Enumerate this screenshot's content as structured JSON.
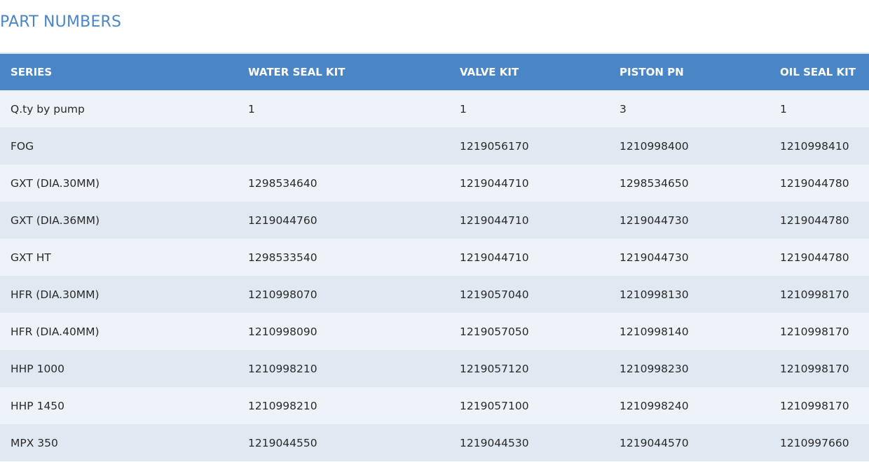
{
  "page": {
    "title": "PART NUMBERS"
  },
  "colors": {
    "accent": "#4a86c5",
    "row_light": "#eef3f9",
    "row_dark": "#e0e8f1"
  },
  "table": {
    "headers": [
      "SERIES",
      "WATER SEAL KIT",
      "VALVE KIT",
      "PISTON PN",
      "OIL SEAL KIT"
    ],
    "rows": [
      [
        "Q.ty by pump",
        "1",
        "1",
        "3",
        "1"
      ],
      [
        "FOG",
        "",
        "1219056170",
        "1210998400",
        "1210998410"
      ],
      [
        "GXT (DIA.30MM)",
        "1298534640",
        "1219044710",
        "1298534650",
        "1219044780"
      ],
      [
        "GXT (DIA.36MM)",
        "1219044760",
        "1219044710",
        "1219044730",
        "1219044780"
      ],
      [
        "GXT HT",
        "1298533540",
        "1219044710",
        "1219044730",
        "1219044780"
      ],
      [
        "HFR (DIA.30MM)",
        "1210998070",
        "1219057040",
        "1210998130",
        "1210998170"
      ],
      [
        "HFR (DIA.40MM)",
        "1210998090",
        "1219057050",
        "1210998140",
        "1210998170"
      ],
      [
        "HHP 1000",
        "1210998210",
        "1219057120",
        "1210998230",
        "1210998170"
      ],
      [
        "HHP 1450",
        "1210998210",
        "1219057100",
        "1210998240",
        "1210998170"
      ],
      [
        "MPX 350",
        "1219044550",
        "1219044530",
        "1219044570",
        "1210997660"
      ]
    ]
  }
}
